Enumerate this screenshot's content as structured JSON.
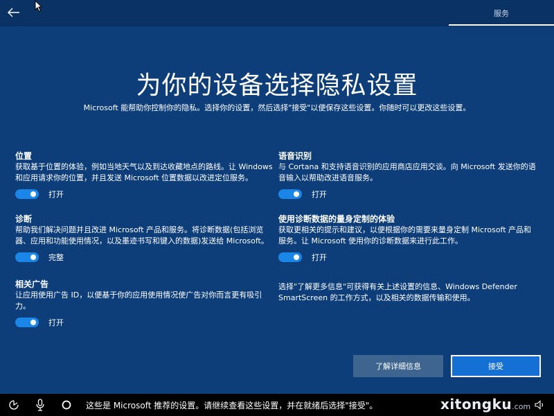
{
  "topbar": {
    "back_icon": "back-arrow-icon",
    "tab_label": "服务"
  },
  "header": {
    "title": "为你的设备选择隐私设置",
    "subtitle": "Microsoft 能帮助你控制你的隐私。选择你的设置，然后选择\"接受\"以便保存这些设置。你随时可以更改这些设置。"
  },
  "settings_left": [
    {
      "title": "位置",
      "desc": "获取基于位置的体验，例如当地天气以及到达收藏地点的路线。让 Windows 和应用请求你的位置，并且发送 Microsoft 位置数据以改进定位服务。",
      "state": "打开"
    },
    {
      "title": "诊断",
      "desc": "帮助我们解决问题并且改进 Microsoft 产品和服务。将诊断数据(包括浏览器、应用和功能使用情况，以及墨迹书写和键入的数据)发送给 Microsoft。",
      "state": "完整"
    },
    {
      "title": "相关广告",
      "desc": "让应用使用广告 ID，以便基于你的应用使用情况使广告对你而言更有吸引力。",
      "state": "打开"
    }
  ],
  "settings_right": [
    {
      "title": "语音识别",
      "desc": "与 Cortana 和支持语音识别的应用商店应用交谈。向 Microsoft 发送你的语音输入以帮助改进语音服务。",
      "state": "打开"
    },
    {
      "title": "使用诊断数据的量身定制的体验",
      "desc": "获取更相关的提示和建议，以便根据你的需要来量身定制 Microsoft 产品和服务。让 Microsoft 使用你的诊断数据来进行此工作。",
      "state": "打开"
    }
  ],
  "info_note": "选择\"了解更多信息\"可获得有关上述设置的信息、Windows Defender SmartScreen 的工作方式，以及相关的数据传输和使用。",
  "buttons": {
    "learn_more": "了解详细信息",
    "accept": "接受"
  },
  "bottombar": {
    "message": "这些是 Microsoft 推荐的设置。请继续查看这些设置，并在就绪后选择\"接受\"。",
    "icons": [
      "ease-of-access-icon",
      "microphone-icon",
      "cortana-circle-icon",
      "volume-icon"
    ],
    "watermark_main": "xitongku",
    "watermark_suffix": ".com"
  },
  "colors": {
    "background": "#0d3e7a",
    "toggle_on": "#1a86e8",
    "accept_button": "#1570d6",
    "learn_button": "#3d6590"
  }
}
